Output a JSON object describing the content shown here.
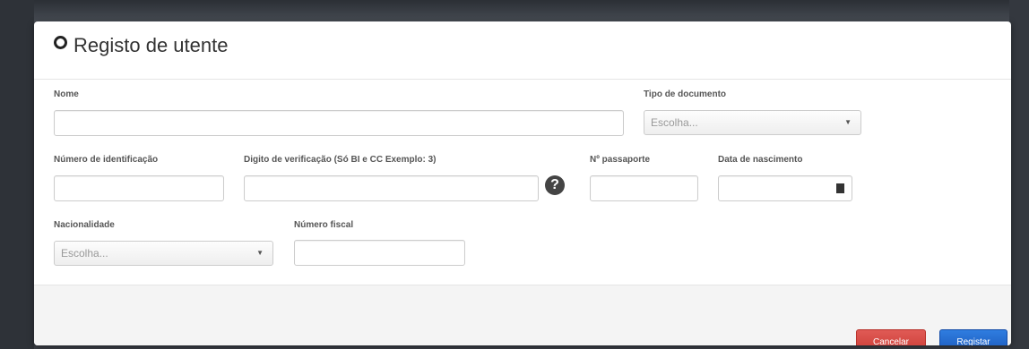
{
  "modal": {
    "title": "Registo de utente"
  },
  "form": {
    "nome_label": "Nome",
    "tipo_documento_label": "Tipo de documento",
    "tipo_documento_value": "Escolha...",
    "numero_identificacao_label": "Número de identificação",
    "digito_verificacao_label": "Digito de verificação (Só BI e CC Exemplo: 3)",
    "passaporte_label": "Nº passaporte",
    "data_nascimento_label": "Data de nascimento",
    "nacionalidade_label": "Nacionalidade",
    "nacionalidade_value": "Escolha...",
    "numero_fiscal_label": "Número fiscal"
  },
  "icons": {
    "help": "?",
    "select_arrow": "▼"
  },
  "footer": {
    "cancel_label": "Cancelar",
    "register_label": "Registar"
  },
  "colors": {
    "cancel": "#d9534f",
    "register": "#2a6fd6"
  }
}
